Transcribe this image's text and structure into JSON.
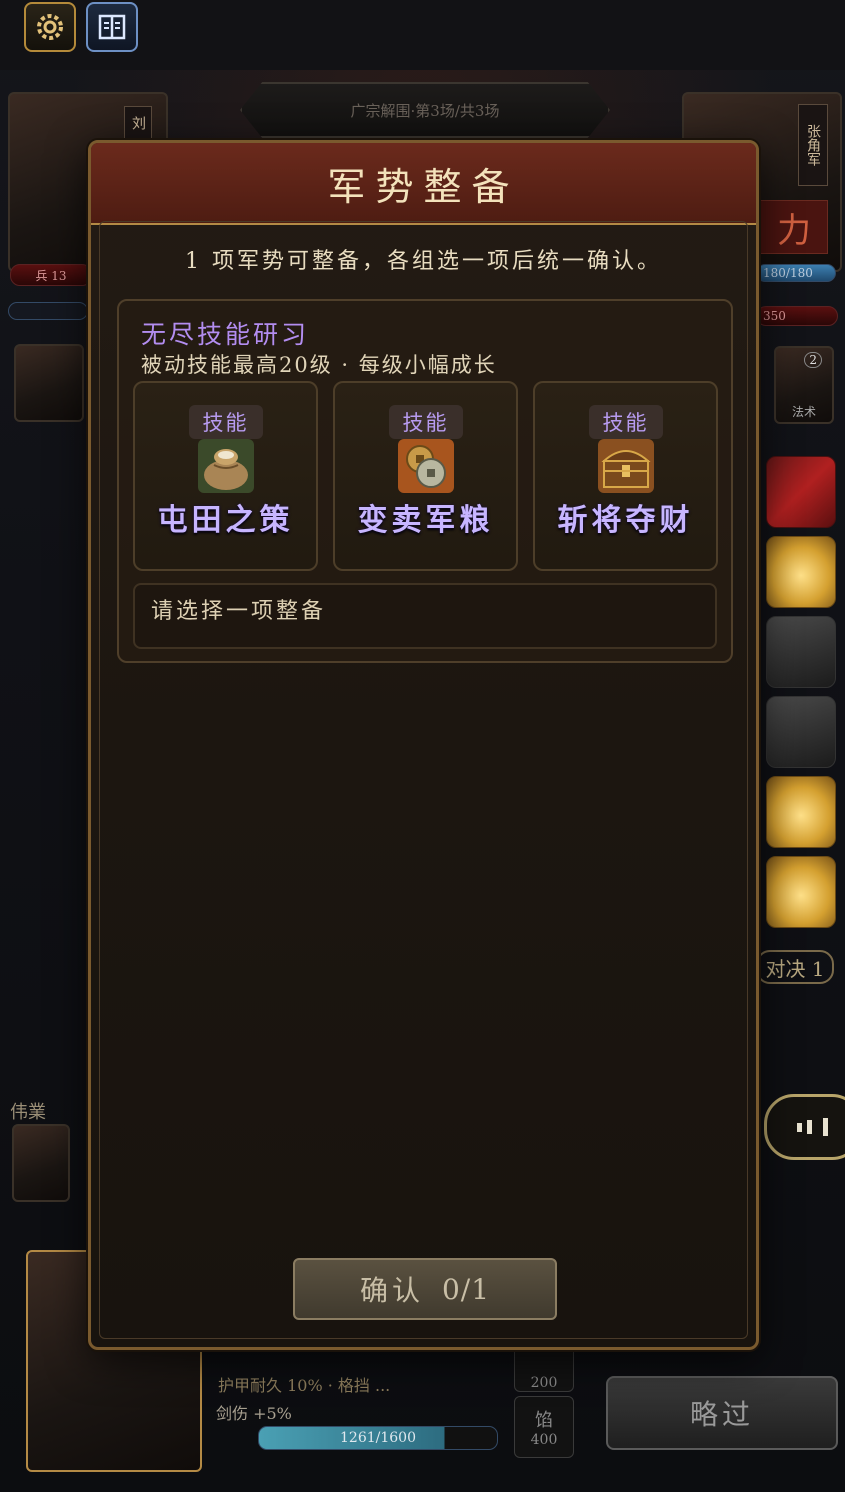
{
  "topbar": {
    "settings_icon": "gear-icon",
    "codex_icon": "book-icon"
  },
  "battle": {
    "stage_label": "广宗解围·第3场/共3场"
  },
  "left_hero": {
    "name_tag": "刘",
    "hp_text": "兵 13"
  },
  "right_hero": {
    "name_tag": "张角军",
    "power_glyph": "力",
    "hp_text": "180/180",
    "bar_text": "350",
    "badge_count": "2",
    "badge_label": "法术"
  },
  "side": {
    "left_label": "伟業",
    "duel_label": "对决 1"
  },
  "bottom": {
    "stat_line1": "护甲耐久 10% · 格挡 ...",
    "stat_line2": "剑伤 +5%",
    "exp_text": "1261/1600",
    "slot_top_value": "200",
    "slot_bottom_label": "馅",
    "slot_bottom_value": "400",
    "skip_label": "略过"
  },
  "modal": {
    "title": "军势整备",
    "subtitle": "1 项军势可整备，各组选一项后统一确认。",
    "group": {
      "name": "无尽技能研习",
      "desc": "被动技能最高20级  ·  每级小幅成长",
      "cards": [
        {
          "badge": "技能",
          "icon": "grain-sack-icon",
          "name": "屯田之策"
        },
        {
          "badge": "技能",
          "icon": "coins-icon",
          "name": "变卖军粮"
        },
        {
          "badge": "技能",
          "icon": "treasure-chest-icon",
          "name": "斩将夺财"
        }
      ],
      "hint": "请选择一项整备"
    },
    "confirm_label": "确认",
    "confirm_count": "0/1"
  },
  "colors": {
    "accent_purple": "#b38df0",
    "header_red": "#6b2a1c",
    "border_gold": "#7a5a2e"
  }
}
